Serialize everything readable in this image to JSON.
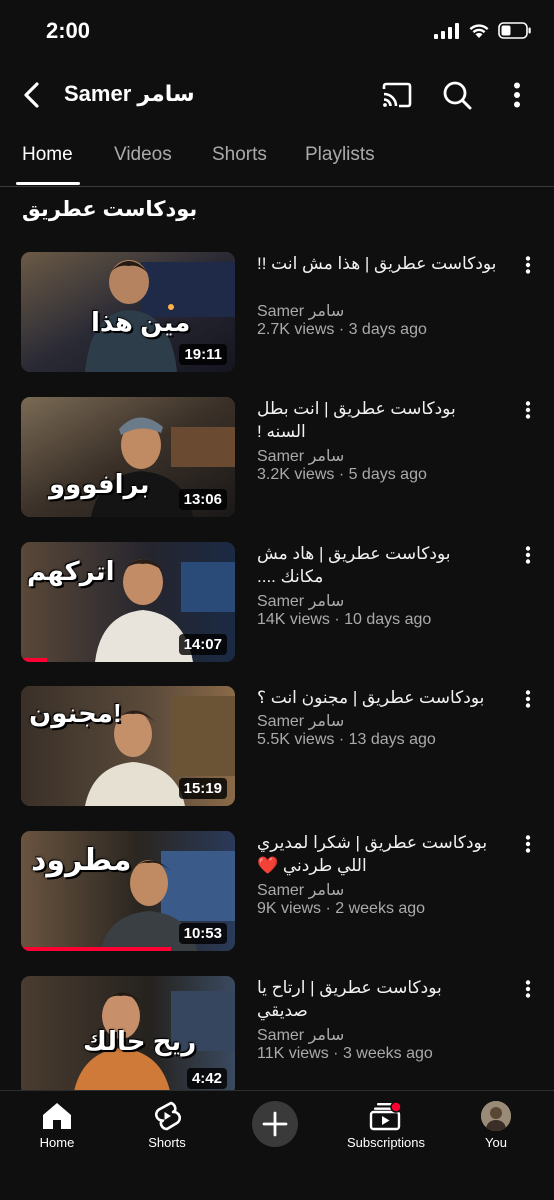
{
  "status_bar": {
    "time": "2:00"
  },
  "header": {
    "title": "Samer سامر"
  },
  "tabs": [
    {
      "label": "Home"
    },
    {
      "label": "Videos"
    },
    {
      "label": "Shorts"
    },
    {
      "label": "Playlists"
    }
  ],
  "section": {
    "title": "بودكاست عطريق"
  },
  "videos": [
    {
      "title": "بودكاست عطريق | هذا مش انت !!",
      "channel": "Samer سامر",
      "stats": "2.7K views · 3 days ago",
      "duration": "19:11",
      "caption": "مين هذا",
      "watched_fraction": 0
    },
    {
      "title": "بودكاست عطريق | انت بطل السنه !",
      "channel": "Samer سامر",
      "stats": "3.2K views · 5 days ago",
      "duration": "13:06",
      "caption": "برافووو",
      "watched_fraction": 0
    },
    {
      "title": "بودكاست عطريق | هاد مش مكانك ....",
      "channel": "Samer سامر",
      "stats": "14K views · 10 days ago",
      "duration": "14:07",
      "caption": "اتركهم",
      "watched_fraction": 0.12
    },
    {
      "title": "بودكاست عطريق | مجنون انت ؟",
      "channel": "Samer سامر",
      "stats": "5.5K views · 13 days ago",
      "duration": "15:19",
      "caption": "مجنون!",
      "watched_fraction": 0
    },
    {
      "title": "بودكاست عطريق | شكرا لمديري اللي طردني ❤️",
      "channel": "Samer سامر",
      "stats": "9K views · 2 weeks ago",
      "duration": "10:53",
      "caption": "مطرود",
      "watched_fraction": 0.7
    },
    {
      "title": "بودكاست عطريق | ارتاح يا صديقي",
      "channel": "Samer سامر",
      "stats": "11K views · 3 weeks ago",
      "duration": "4:42",
      "caption": "ريح حالك",
      "watched_fraction": 0
    }
  ],
  "bottom_nav": [
    {
      "label": "Home",
      "icon": "home-icon"
    },
    {
      "label": "Shorts",
      "icon": "shorts-icon"
    },
    {
      "label": "",
      "icon": "create-plus-icon"
    },
    {
      "label": "Subscriptions",
      "icon": "subscriptions-icon"
    },
    {
      "label": "You",
      "icon": "avatar"
    }
  ],
  "colors": {
    "background": "#0f0f0f",
    "progress": "#ff0033",
    "secondary_text": "#aaaaaa"
  }
}
